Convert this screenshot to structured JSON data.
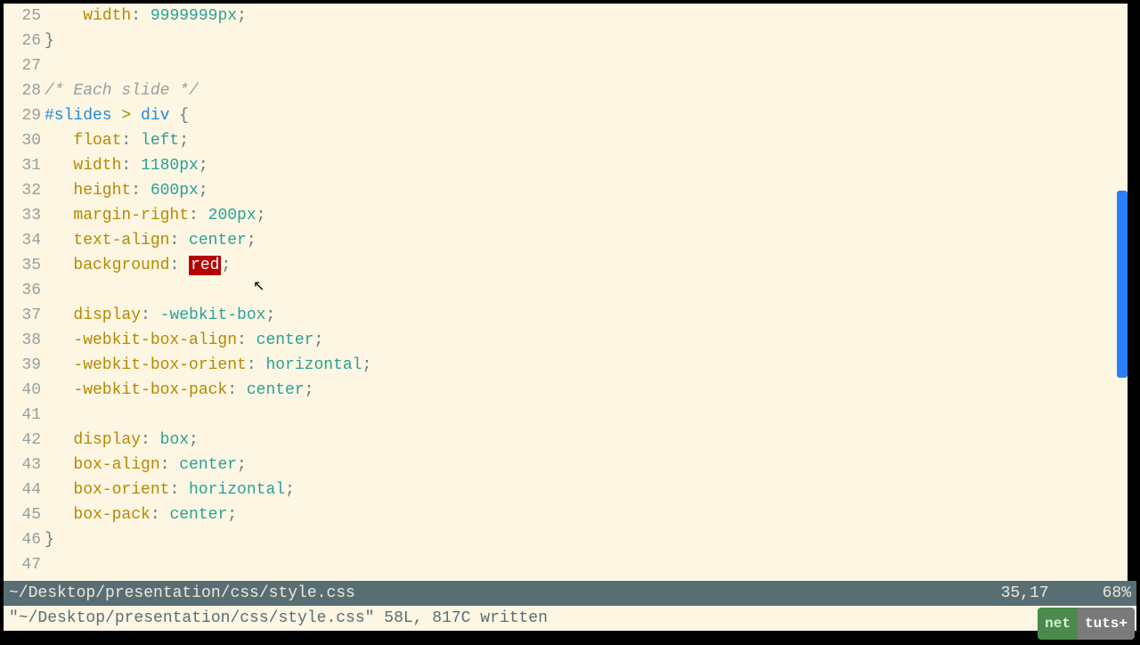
{
  "lines": [
    {
      "n": 25,
      "seg": [
        {
          "t": "    ",
          "c": ""
        },
        {
          "t": "width",
          "c": "c-prop"
        },
        {
          "t": ": ",
          "c": "c-punc"
        },
        {
          "t": "9999999px",
          "c": "c-val"
        },
        {
          "t": ";",
          "c": "c-punc"
        }
      ]
    },
    {
      "n": 26,
      "seg": [
        {
          "t": "}",
          "c": "c-brace"
        }
      ]
    },
    {
      "n": 27,
      "seg": [
        {
          "t": "",
          "c": ""
        }
      ]
    },
    {
      "n": 28,
      "seg": [
        {
          "t": "/* Each slide */",
          "c": "c-comment"
        }
      ]
    },
    {
      "n": 29,
      "seg": [
        {
          "t": "#slides",
          "c": "c-sel"
        },
        {
          "t": " > ",
          "c": "c-op"
        },
        {
          "t": "div",
          "c": "c-tag"
        },
        {
          "t": " {",
          "c": "c-brace"
        }
      ]
    },
    {
      "n": 30,
      "seg": [
        {
          "t": "   ",
          "c": ""
        },
        {
          "t": "float",
          "c": "c-prop"
        },
        {
          "t": ": ",
          "c": "c-punc"
        },
        {
          "t": "left",
          "c": "c-val"
        },
        {
          "t": ";",
          "c": "c-punc"
        }
      ]
    },
    {
      "n": 31,
      "seg": [
        {
          "t": "   ",
          "c": ""
        },
        {
          "t": "width",
          "c": "c-prop"
        },
        {
          "t": ": ",
          "c": "c-punc"
        },
        {
          "t": "1180px",
          "c": "c-val"
        },
        {
          "t": ";",
          "c": "c-punc"
        }
      ]
    },
    {
      "n": 32,
      "seg": [
        {
          "t": "   ",
          "c": ""
        },
        {
          "t": "height",
          "c": "c-prop"
        },
        {
          "t": ": ",
          "c": "c-punc"
        },
        {
          "t": "600px",
          "c": "c-val"
        },
        {
          "t": ";",
          "c": "c-punc"
        }
      ]
    },
    {
      "n": 33,
      "seg": [
        {
          "t": "   ",
          "c": ""
        },
        {
          "t": "margin-right",
          "c": "c-prop"
        },
        {
          "t": ": ",
          "c": "c-punc"
        },
        {
          "t": "200px",
          "c": "c-val"
        },
        {
          "t": ";",
          "c": "c-punc"
        }
      ]
    },
    {
      "n": 34,
      "seg": [
        {
          "t": "   ",
          "c": ""
        },
        {
          "t": "text-align",
          "c": "c-prop"
        },
        {
          "t": ": ",
          "c": "c-punc"
        },
        {
          "t": "center",
          "c": "c-val"
        },
        {
          "t": ";",
          "c": "c-punc"
        }
      ]
    },
    {
      "n": 35,
      "seg": [
        {
          "t": "   ",
          "c": ""
        },
        {
          "t": "background",
          "c": "c-prop"
        },
        {
          "t": ": ",
          "c": "c-punc"
        },
        {
          "t": "red",
          "c": "cursor-cell"
        },
        {
          "t": ";",
          "c": "c-punc"
        }
      ]
    },
    {
      "n": 36,
      "seg": [
        {
          "t": "",
          "c": ""
        }
      ]
    },
    {
      "n": 37,
      "seg": [
        {
          "t": "   ",
          "c": ""
        },
        {
          "t": "display",
          "c": "c-prop"
        },
        {
          "t": ": ",
          "c": "c-punc"
        },
        {
          "t": "-webkit-box",
          "c": "c-val"
        },
        {
          "t": ";",
          "c": "c-punc"
        }
      ]
    },
    {
      "n": 38,
      "seg": [
        {
          "t": "   ",
          "c": ""
        },
        {
          "t": "-webkit-box-align",
          "c": "c-prop"
        },
        {
          "t": ": ",
          "c": "c-punc"
        },
        {
          "t": "center",
          "c": "c-val"
        },
        {
          "t": ";",
          "c": "c-punc"
        }
      ]
    },
    {
      "n": 39,
      "seg": [
        {
          "t": "   ",
          "c": ""
        },
        {
          "t": "-webkit-box-orient",
          "c": "c-prop"
        },
        {
          "t": ": ",
          "c": "c-punc"
        },
        {
          "t": "horizontal",
          "c": "c-val"
        },
        {
          "t": ";",
          "c": "c-punc"
        }
      ]
    },
    {
      "n": 40,
      "seg": [
        {
          "t": "   ",
          "c": ""
        },
        {
          "t": "-webkit-box-pack",
          "c": "c-prop"
        },
        {
          "t": ": ",
          "c": "c-punc"
        },
        {
          "t": "center",
          "c": "c-val"
        },
        {
          "t": ";",
          "c": "c-punc"
        }
      ]
    },
    {
      "n": 41,
      "seg": [
        {
          "t": "",
          "c": ""
        }
      ]
    },
    {
      "n": 42,
      "seg": [
        {
          "t": "   ",
          "c": ""
        },
        {
          "t": "display",
          "c": "c-prop"
        },
        {
          "t": ": ",
          "c": "c-punc"
        },
        {
          "t": "box",
          "c": "c-val"
        },
        {
          "t": ";",
          "c": "c-punc"
        }
      ]
    },
    {
      "n": 43,
      "seg": [
        {
          "t": "   ",
          "c": ""
        },
        {
          "t": "box-align",
          "c": "c-prop"
        },
        {
          "t": ": ",
          "c": "c-punc"
        },
        {
          "t": "center",
          "c": "c-val"
        },
        {
          "t": ";",
          "c": "c-punc"
        }
      ]
    },
    {
      "n": 44,
      "seg": [
        {
          "t": "   ",
          "c": ""
        },
        {
          "t": "box-orient",
          "c": "c-prop"
        },
        {
          "t": ": ",
          "c": "c-punc"
        },
        {
          "t": "horizontal",
          "c": "c-val"
        },
        {
          "t": ";",
          "c": "c-punc"
        }
      ]
    },
    {
      "n": 45,
      "seg": [
        {
          "t": "   ",
          "c": ""
        },
        {
          "t": "box-pack",
          "c": "c-prop"
        },
        {
          "t": ": ",
          "c": "c-punc"
        },
        {
          "t": "center",
          "c": "c-val"
        },
        {
          "t": ";",
          "c": "c-punc"
        }
      ]
    },
    {
      "n": 46,
      "seg": [
        {
          "t": "}",
          "c": "c-brace"
        }
      ]
    },
    {
      "n": 47,
      "seg": [
        {
          "t": "",
          "c": ""
        }
      ]
    }
  ],
  "status": {
    "path": "~/Desktop/presentation/css/style.css",
    "pos": "35,17",
    "pct": "68%"
  },
  "cmdline": "\"~/Desktop/presentation/css/style.css\" 58L, 817C written",
  "logo": {
    "a": "net",
    "b": "tuts+"
  }
}
